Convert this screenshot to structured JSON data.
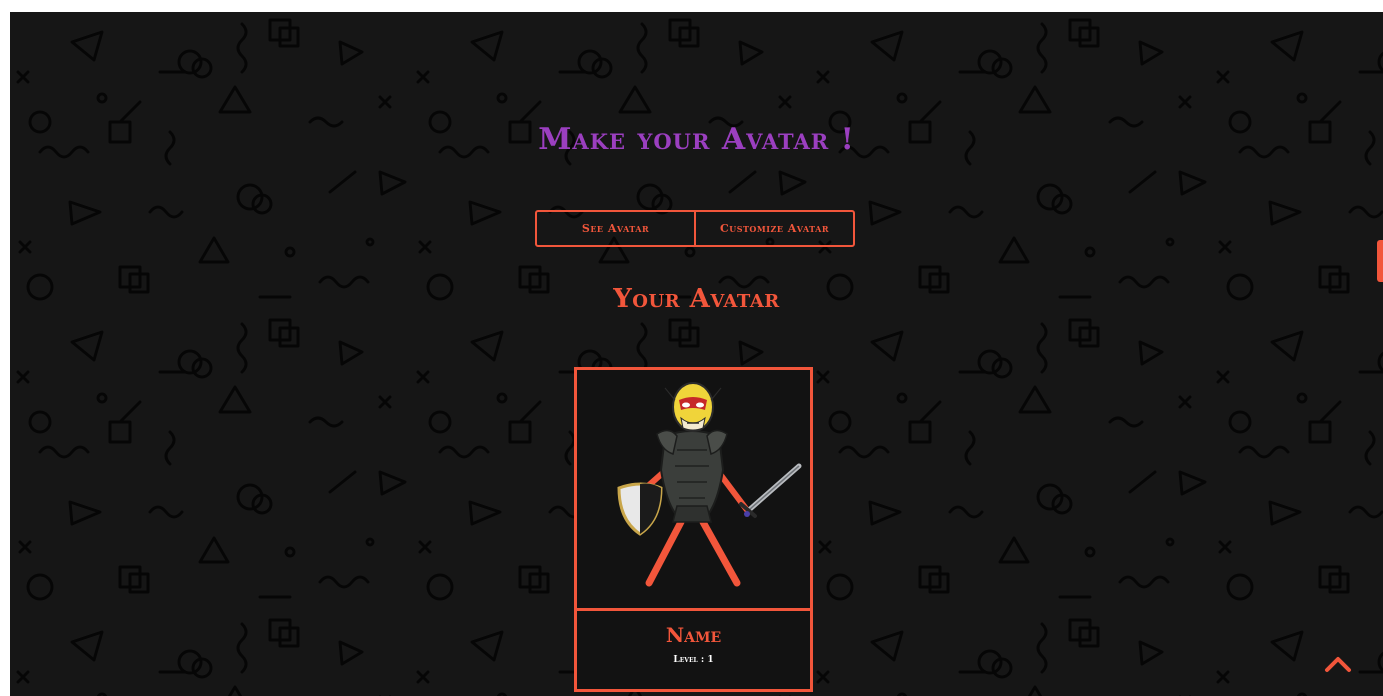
{
  "header": {
    "title": "Make your Avatar !"
  },
  "tabs": [
    {
      "label": "See Avatar"
    },
    {
      "label": "Customize Avatar"
    }
  ],
  "section": {
    "title": "Your Avatar"
  },
  "card": {
    "name": "Name",
    "level": "Level : 1"
  },
  "icons": {
    "scroll_top": "chevron-up-icon",
    "avatar": "avatar-figure-icon"
  },
  "colors": {
    "background": "#161616",
    "accent": "#f2563b",
    "title": "#9b3fc0",
    "pattern": "#060606"
  }
}
